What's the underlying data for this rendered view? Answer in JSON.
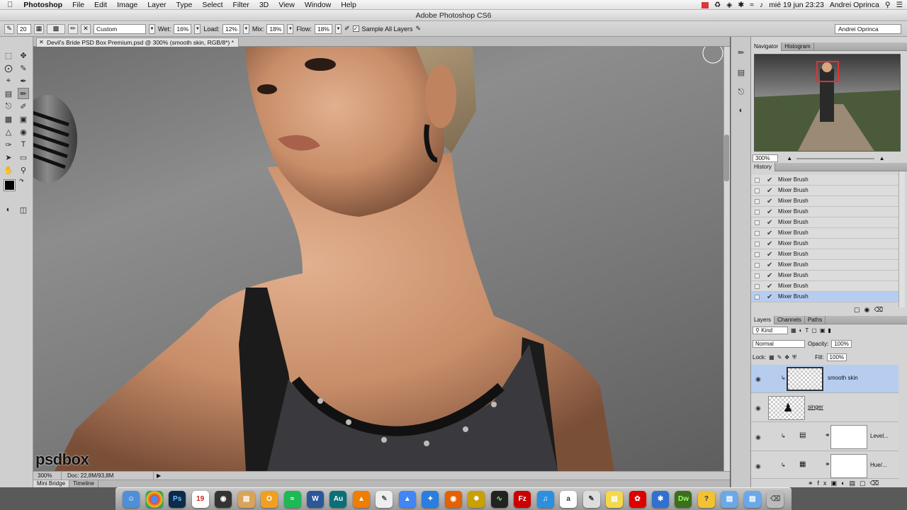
{
  "menubar": {
    "app": "Photoshop",
    "items": [
      "File",
      "Edit",
      "Image",
      "Layer",
      "Type",
      "Select",
      "Filter",
      "3D",
      "View",
      "Window",
      "Help"
    ],
    "clock": "mié 19 jun  23:23",
    "user": "Andrei Oprinca"
  },
  "window_title": "Adobe Photoshop CS6",
  "options": {
    "brush_size": "20",
    "preset": "Custom",
    "wet_label": "Wet:",
    "wet": "16%",
    "load_label": "Load:",
    "load": "12%",
    "mix_label": "Mix:",
    "mix": "18%",
    "flow_label": "Flow:",
    "flow": "18%",
    "sample_all_layers": "Sample All Layers",
    "workspace": "Andrei Oprinca"
  },
  "document": {
    "tab_title": "Devil's Bride PSD Box Premium.psd @ 300% (smooth skin, RGB/8*) *",
    "zoom": "300%",
    "doc_size": "Doc: 22,8M/93,8M",
    "logo": "psdbox"
  },
  "bottom_tabs": [
    "Mini Bridge",
    "Timeline"
  ],
  "navigator": {
    "tabs": [
      "Navigator",
      "Histogram"
    ],
    "zoom": "300%"
  },
  "history": {
    "title": "History",
    "items": [
      "Mixer Brush",
      "Mixer Brush",
      "Mixer Brush",
      "Mixer Brush",
      "Mixer Brush",
      "Mixer Brush",
      "Mixer Brush",
      "Mixer Brush",
      "Mixer Brush",
      "Mixer Brush",
      "Mixer Brush",
      "Mixer Brush"
    ]
  },
  "layers_panel": {
    "tabs": [
      "Layers",
      "Channels",
      "Paths"
    ],
    "filter": "Kind",
    "blend_mode": "Normal",
    "opacity_label": "Opacity:",
    "opacity": "100%",
    "lock_label": "Lock:",
    "fill_label": "Fill:",
    "fill": "100%",
    "layers": [
      {
        "name": "smooth skin"
      },
      {
        "name": "singer"
      },
      {
        "name": "Level..."
      },
      {
        "name": "Hue/..."
      }
    ]
  },
  "dock": {
    "items": [
      "Finder",
      "Chrome",
      "Ps",
      "Calendar",
      "Camera",
      "Preview",
      "Outlook",
      "Spotify",
      "Word",
      "Audition",
      "VLC",
      "Script",
      "Drive",
      "Safari",
      "Firefox",
      "Illustrator",
      "Monitor",
      "FileZilla",
      "iTunes",
      "Dictionary",
      "Script Editor",
      "Stickies",
      "Acrobat",
      "Bluetooth",
      "Dreamweaver",
      "Help",
      "Folder",
      "Folder",
      "Trash"
    ],
    "calendar_day": "19"
  }
}
